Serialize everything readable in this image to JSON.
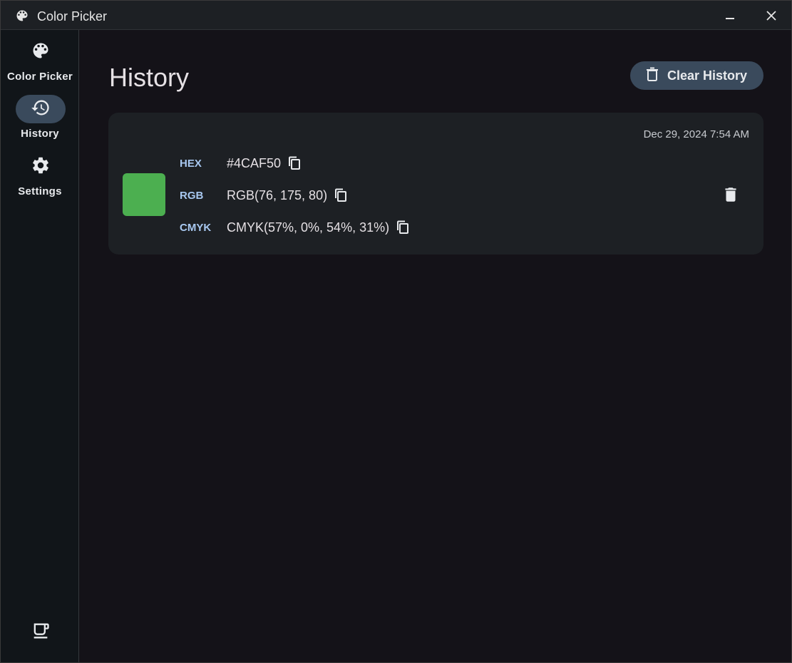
{
  "window": {
    "title": "Color Picker"
  },
  "sidebar": {
    "items": [
      {
        "label": "Color Picker",
        "icon": "palette-icon",
        "active": false
      },
      {
        "label": "History",
        "icon": "history-icon",
        "active": true
      },
      {
        "label": "Settings",
        "icon": "gear-icon",
        "active": false
      }
    ],
    "footer_icon": "coffee-icon"
  },
  "page": {
    "title": "History",
    "clear_button_label": "Clear History"
  },
  "history": [
    {
      "timestamp": "Dec 29, 2024 7:54 AM",
      "swatch_color": "#4CAF50",
      "formats": [
        {
          "key": "HEX",
          "value": "#4CAF50"
        },
        {
          "key": "RGB",
          "value": "RGB(76, 175, 80)"
        },
        {
          "key": "CMYK",
          "value": "CMYK(57%, 0%, 54%, 31%)"
        }
      ]
    }
  ],
  "colors": {
    "accent_label": "#a8c8f0",
    "active_pill": "#3a4a5c",
    "card_bg": "#1d2024",
    "app_bg": "#141218"
  }
}
